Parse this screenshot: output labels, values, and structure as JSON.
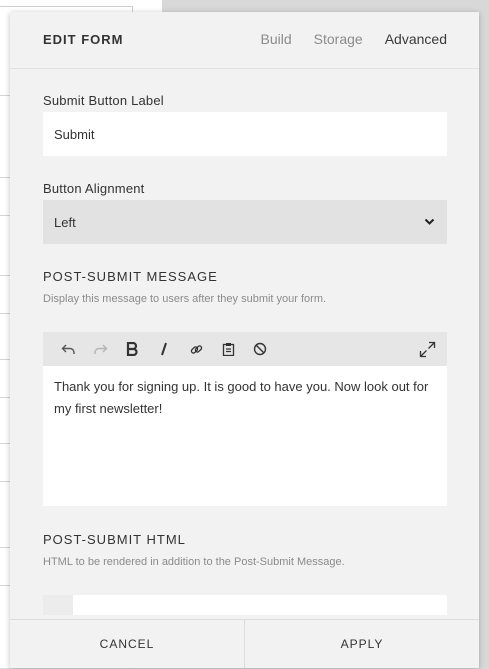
{
  "header": {
    "title": "EDIT FORM",
    "tabs": [
      "Build",
      "Storage",
      "Advanced"
    ],
    "active_tab": "Advanced"
  },
  "submit_button_label": {
    "label": "Submit Button Label",
    "value": "Submit"
  },
  "button_alignment": {
    "label": "Button Alignment",
    "selected": "Left"
  },
  "post_submit_message": {
    "title": "POST-SUBMIT MESSAGE",
    "help": "Display this message to users after they submit your form.",
    "content": "Thank you for signing up. It is good to have you. Now look out for my first newsletter!",
    "toolbar_icons": [
      "undo-icon",
      "redo-icon",
      "bold-icon",
      "italic-icon",
      "link-icon",
      "paste-icon",
      "clear-format-icon",
      "expand-icon"
    ]
  },
  "post_submit_html": {
    "title": "POST-SUBMIT HTML",
    "help": "HTML to be rendered in addition to the Post-Submit Message."
  },
  "footer": {
    "cancel": "CANCEL",
    "apply": "APPLY"
  }
}
